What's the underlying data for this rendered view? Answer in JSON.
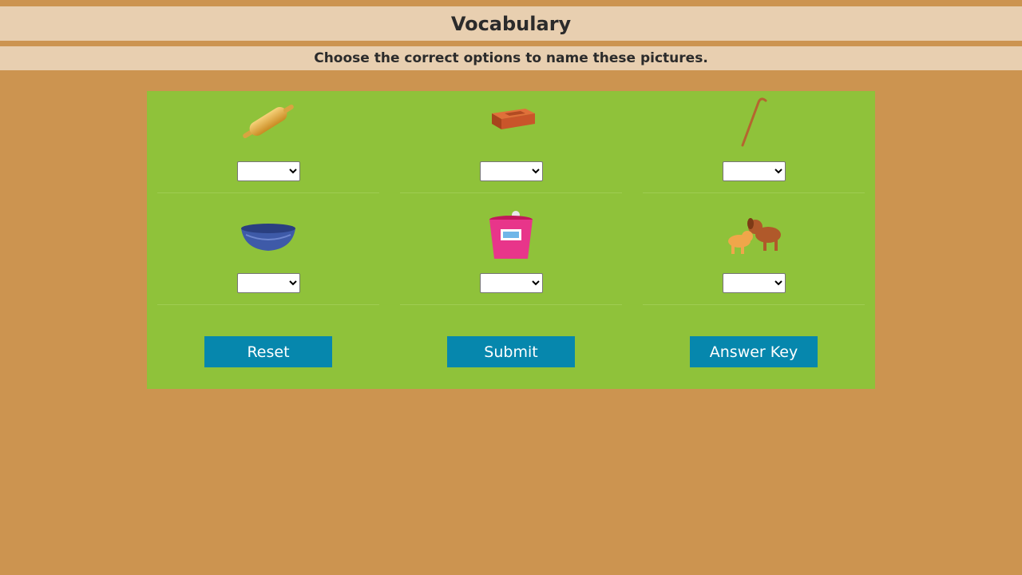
{
  "header": {
    "title": "Vocabulary",
    "instruction": "Choose the correct options to name these pictures."
  },
  "items": [
    {
      "picture": "rolling-pin-icon",
      "selected": ""
    },
    {
      "picture": "brick-icon",
      "selected": ""
    },
    {
      "picture": "walking-stick-icon",
      "selected": ""
    },
    {
      "picture": "bowl-icon",
      "selected": ""
    },
    {
      "picture": "dustbin-icon",
      "selected": ""
    },
    {
      "picture": "playing-dogs-icon",
      "selected": ""
    }
  ],
  "buttons": {
    "reset": "Reset",
    "submit": "Submit",
    "answer_key": "Answer Key"
  },
  "colors": {
    "background": "#cc9450",
    "header_bar": "#e8cfb0",
    "panel": "#8fc23a",
    "button": "#0687ad"
  }
}
